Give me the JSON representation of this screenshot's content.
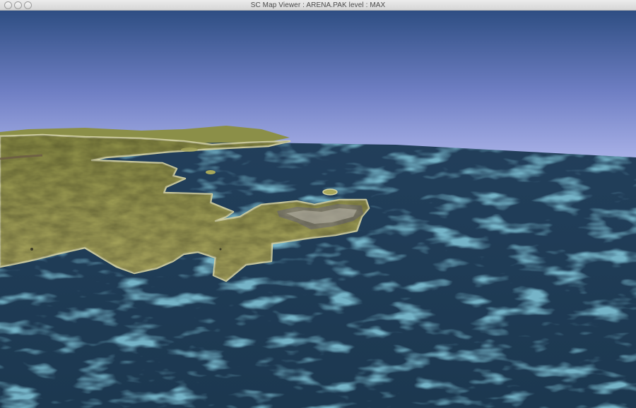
{
  "window": {
    "title": "SC Map Viewer : ARENA.PAK level : MAX",
    "buttons": [
      "close",
      "minimize",
      "zoom"
    ]
  },
  "scene": {
    "type": "3d-terrain-render",
    "sky_colors": {
      "top": "#2f4f84",
      "horizon": "#a7b0e6"
    },
    "water_colors": {
      "deep": "#1e3b55",
      "shallow": "#2f7594"
    },
    "land_colors": {
      "grass": "#a8a85a",
      "shore": "#cfcfa0"
    },
    "city_icon": "city-cluster-icon"
  }
}
